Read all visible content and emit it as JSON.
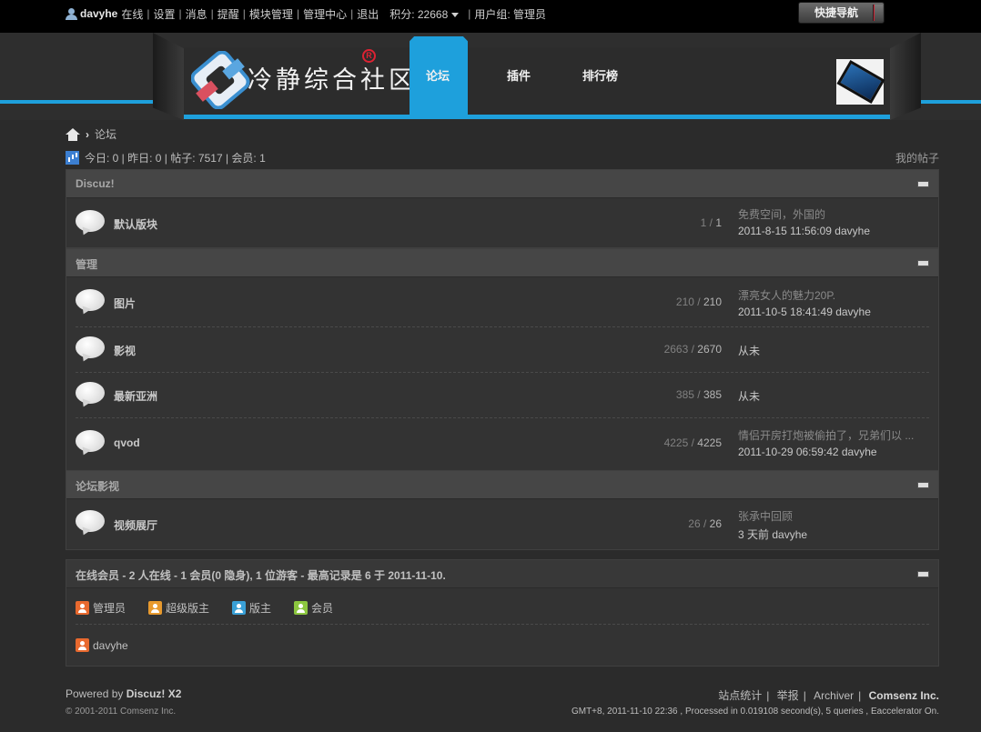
{
  "topbar": {
    "username": "davyhe",
    "status": "在线",
    "links": [
      "设置",
      "消息",
      "提醒",
      "模块管理",
      "管理中心",
      "退出"
    ],
    "points_label": "积分: 22668",
    "usergroup": "用户组: 管理员",
    "quicknav_label": "快捷导航"
  },
  "header": {
    "logo_text": "冷静综合社区",
    "logo_reg": "R",
    "nav": [
      "论坛",
      "插件",
      "排行榜"
    ],
    "active_nav": "论坛"
  },
  "breadcrumb": {
    "current": "论坛"
  },
  "stats": {
    "text": "今日: 0 | 昨日: 0 | 帖子: 7517 | 会员: 1",
    "my_threads": "我的帖子"
  },
  "sections": [
    {
      "title": "Discuz!",
      "forums": [
        {
          "name": "默认版块",
          "threads": "1",
          "posts": "1",
          "last_title": "免费空间，外国的",
          "last_meta": "2011-8-15 11:56:09 davyhe"
        }
      ]
    },
    {
      "title": "管理",
      "forums": [
        {
          "name": "图片",
          "threads": "210",
          "posts": "210",
          "last_title": "漂亮女人的魅力20P.",
          "last_meta": "2011-10-5 18:41:49 davyhe"
        },
        {
          "name": "影视",
          "threads": "2663",
          "posts": "2670",
          "last_never": "从未"
        },
        {
          "name": "最新亚洲",
          "threads": "385",
          "posts": "385",
          "last_never": "从未"
        },
        {
          "name": "qvod",
          "threads": "4225",
          "posts": "4225",
          "last_title": "情侣开房打炮被偷拍了，兄弟们以 ...",
          "last_meta": "2011-10-29 06:59:42 davyhe"
        }
      ]
    },
    {
      "title": "论坛影视",
      "forums": [
        {
          "name": "视频展厅",
          "threads": "26",
          "posts": "26",
          "last_title": "张承中回顾",
          "last_meta": "3 天前 davyhe"
        }
      ]
    }
  ],
  "online": {
    "label": "在线会员",
    "summary": "- 2 人在线 - 1 会员(0 隐身), 1 位游客 - 最高记录是 6 于 2011-11-10.",
    "legend": [
      {
        "label": "管理员",
        "color": "#e8692e"
      },
      {
        "label": "超级版主",
        "color": "#e89a2e"
      },
      {
        "label": "版主",
        "color": "#3aa0d6"
      },
      {
        "label": "会员",
        "color": "#8cc63f"
      }
    ],
    "users": [
      "davyhe"
    ]
  },
  "footer": {
    "powered": "Powered by",
    "product": "Discuz! X2",
    "copyright": "© 2001-2011 Comsenz Inc.",
    "links": [
      "站点统计",
      "举报",
      "Archiver"
    ],
    "company": "Comsenz Inc.",
    "processed": "GMT+8, 2011-11-10 22:36 , Processed in 0.019108 second(s), 5 queries , Eaccelerator On."
  }
}
